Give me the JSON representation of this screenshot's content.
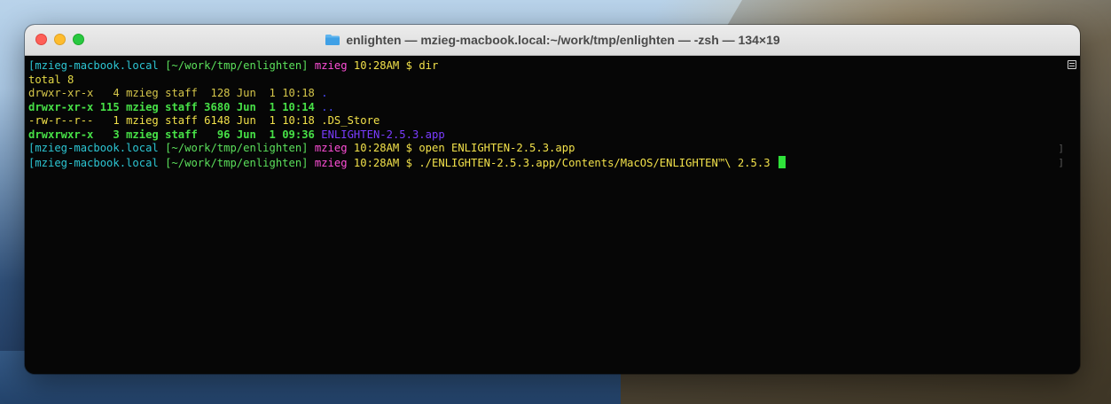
{
  "window": {
    "title": "enlighten — mzieg-macbook.local:~/work/tmp/enlighten — -zsh — 134×19"
  },
  "terminal": {
    "prompt": {
      "host": "[mzieg-macbook.local",
      "path": "[~/work/tmp/enlighten]",
      "user": "mzieg",
      "time": "10:28AM",
      "symbol": "$"
    },
    "commands": [
      "dir",
      "open ENLIGHTEN-2.5.3.app",
      "./ENLIGHTEN-2.5.3.app/Contents/MacOS/ENLIGHTEN™\\ 2.5.3"
    ],
    "total": "total 8",
    "listing": [
      {
        "perms": "drwxr-xr-x",
        "links": "4",
        "owner": "mzieg",
        "group": "staff",
        "size": "128",
        "date": "Jun  1 10:18",
        "name": ".",
        "style": "dir-y"
      },
      {
        "perms": "drwxr-xr-x",
        "links": "115",
        "owner": "mzieg",
        "group": "staff",
        "size": "3680",
        "date": "Jun  1 10:14",
        "name": "..",
        "style": "dir-g"
      },
      {
        "perms": "-rw-r--r--",
        "links": "1",
        "owner": "mzieg",
        "group": "staff",
        "size": "6148",
        "date": "Jun  1 10:18",
        "name": ".DS_Store",
        "style": "file"
      },
      {
        "perms": "drwxrwxr-x",
        "links": "3",
        "owner": "mzieg",
        "group": "staff",
        "size": "96",
        "date": "Jun  1 09:36",
        "name": "ENLIGHTEN-2.5.3.app",
        "style": "app"
      }
    ]
  },
  "icons": {
    "folder": "folder-icon",
    "scroll": "scroll-indicator-icon"
  },
  "colors": {
    "close": "#fe5f57",
    "minimize": "#febc2e",
    "maximize": "#28c840",
    "cursor": "#2fe23a"
  }
}
